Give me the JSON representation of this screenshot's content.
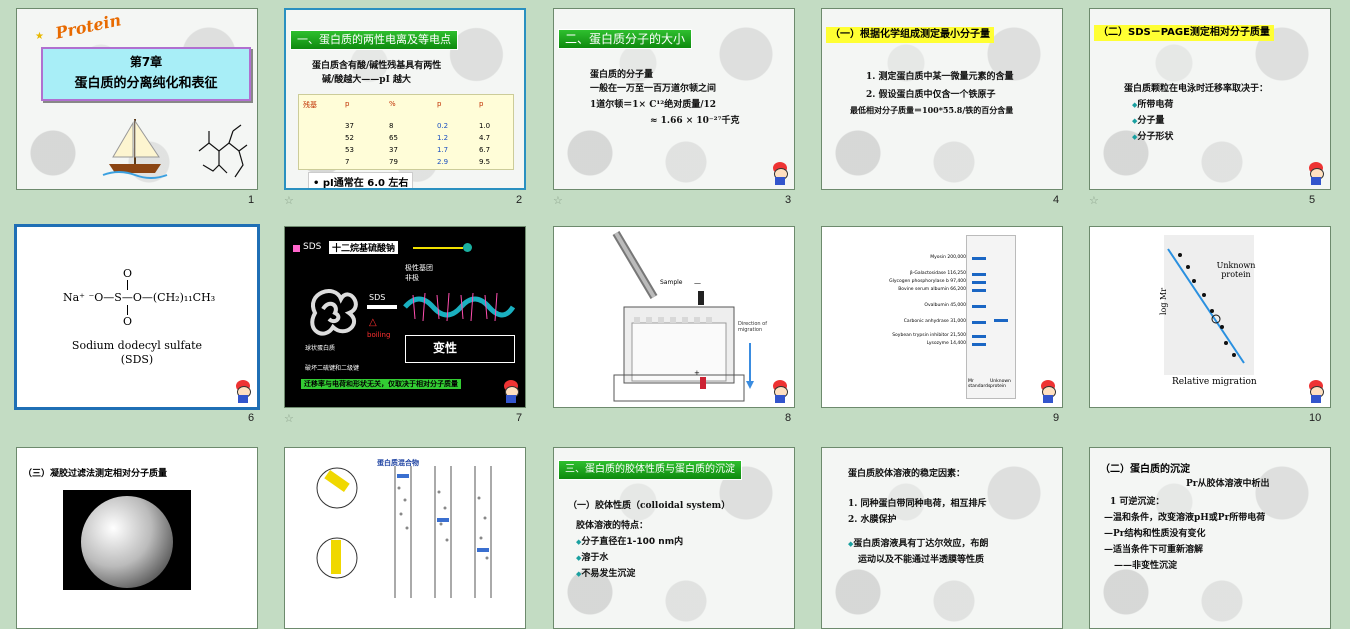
{
  "slides": [
    {
      "num": "1",
      "title": "第7章",
      "subtitle": "蛋白质的分离纯化和表征",
      "logo": "Protein"
    },
    {
      "num": "2",
      "bar": "一、蛋白质的两性电离及等电点",
      "l1": "蛋白质含有酸/碱性残基具有两性",
      "l2": "碱/酸越大——pI 越大",
      "table_head": [
        "残基",
        "p",
        "%",
        "p",
        "p"
      ],
      "rows": [
        [
          "",
          "37",
          "8",
          "0.2",
          "1.0"
        ],
        [
          "",
          "52",
          "65",
          "1.2",
          "4.7"
        ],
        [
          "",
          "53",
          "37",
          "1.7",
          "6.7"
        ],
        [
          "",
          "7",
          "79",
          "2.9",
          "9.5"
        ]
      ],
      "foot": "• pI通常在 6.0 左右"
    },
    {
      "num": "3",
      "bar": "二、蛋白质分子的大小",
      "l1": "蛋白质的分子量",
      "l2": "一般在一万至一百万道尔顿之间",
      "l3": "1道尔顿＝1× C¹²绝对质量/12",
      "l4": "≈ 1.66 × 10⁻²⁷千克"
    },
    {
      "num": "4",
      "bar": "（一）根据化学组成测定最小分子量",
      "l1": "1. 测定蛋白质中某一微量元素的含量",
      "l2": "2. 假设蛋白质中仅含一个铁原子",
      "l3": "最低相对分子质量＝100*55.8/铁的百分含量"
    },
    {
      "num": "5",
      "bar": "（二）SDS－PAGE测定相对分子质量",
      "l1": "蛋白质颗粒在电泳时迁移率取决于：",
      "b1": "所带电荷",
      "b2": "分子量",
      "b3": "分子形状"
    },
    {
      "num": "6",
      "formula_left": "Na⁺  ⁻O—S—O—(CH₂)₁₁CH₃",
      "o_top": "O",
      "o_bot": "O",
      "name": "Sodium dodecyl sulfate",
      "abbr": "(SDS)"
    },
    {
      "num": "7",
      "sds": "SDS",
      "title": "十二烷基硫酸钠",
      "lab1": "极性基团",
      "lab2": "非极",
      "arrow": "SDS",
      "boil": "boiling",
      "den": "变性",
      "c1": "球状蛋白质",
      "c2": "破坏二硫键和二级键",
      "foot": "迁移率与电荷和形状无关，仅取决于相对分子质量"
    },
    {
      "num": "8",
      "sample": "Sample",
      "dir": "Direction of migration",
      "minus": "—",
      "plus": "+"
    },
    {
      "num": "9",
      "ladder": [
        "Myosin 200,000",
        "β-Galactosidase 116,250",
        "Glycogen phosphorylase b 97,400",
        "Bovine serum albumin 66,200",
        "Ovalbumin 45,000",
        "Carbonic anhydrase 31,000",
        "Soybean trypsin inhibitor 21,500",
        "Lysozyme 14,400"
      ],
      "lane1": "Mr standards",
      "lane2": "Unknown protein"
    },
    {
      "num": "10",
      "ylab": "log Mr",
      "xlab": "Relative migration",
      "unk": "Unknown protein"
    },
    {
      "num": "11",
      "bar": "（三）凝胶过滤法测定相对分子质量"
    },
    {
      "num": "12",
      "label": "蛋白质混合物"
    },
    {
      "num": "13",
      "bar": "三、蛋白质的胶体性质与蛋白质的沉淀",
      "sub": "（一）胶体性质（colloidal system）",
      "l1": "胶体溶液的特点：",
      "b1": "分子直径在1-100 nm内",
      "b2": "溶于水",
      "b3": "不易发生沉淀"
    },
    {
      "num": "14",
      "l1": "蛋白质胶体溶液的稳定因素：",
      "l2": "1. 同种蛋白带同种电荷，相互排斥",
      "l3": "2. 水膜保护",
      "b1": "蛋白质溶液具有丁达尔效应，布朗",
      "l4": "运动以及不能通过半透膜等性质"
    },
    {
      "num": "15",
      "bar": "（二）蛋白质的沉淀",
      "l0": "Pr从胶体溶液中析出",
      "l1": "1 可逆沉淀：",
      "l2": "—温和条件，改变溶液pH或Pr所带电荷",
      "l3": "—Pr结构和性质没有变化",
      "l4": "—适当条件下可重新溶解",
      "l5": "——非变性沉淀"
    }
  ]
}
